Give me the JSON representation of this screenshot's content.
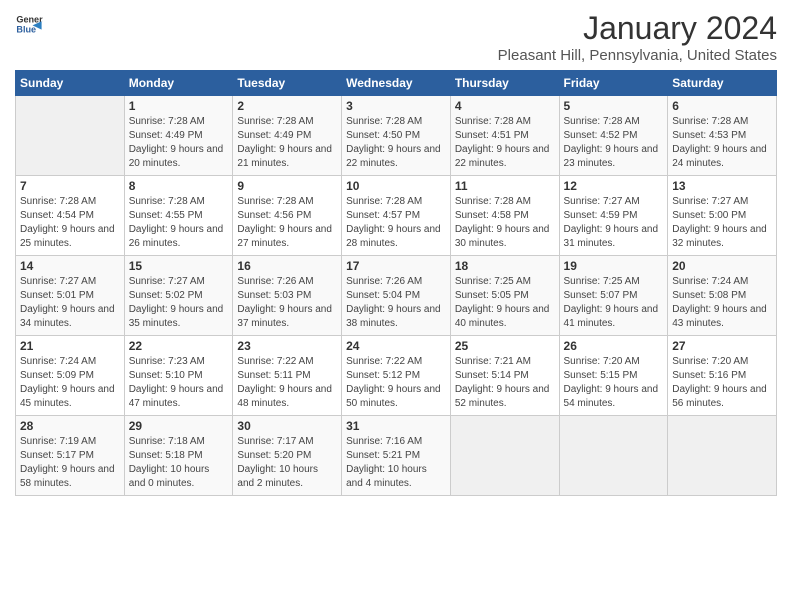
{
  "logo": {
    "general": "General",
    "blue": "Blue"
  },
  "header": {
    "month": "January 2024",
    "location": "Pleasant Hill, Pennsylvania, United States"
  },
  "weekdays": [
    "Sunday",
    "Monday",
    "Tuesday",
    "Wednesday",
    "Thursday",
    "Friday",
    "Saturday"
  ],
  "weeks": [
    [
      {
        "day": "",
        "sunrise": "",
        "sunset": "",
        "daylight": ""
      },
      {
        "day": "1",
        "sunrise": "Sunrise: 7:28 AM",
        "sunset": "Sunset: 4:49 PM",
        "daylight": "Daylight: 9 hours and 20 minutes."
      },
      {
        "day": "2",
        "sunrise": "Sunrise: 7:28 AM",
        "sunset": "Sunset: 4:49 PM",
        "daylight": "Daylight: 9 hours and 21 minutes."
      },
      {
        "day": "3",
        "sunrise": "Sunrise: 7:28 AM",
        "sunset": "Sunset: 4:50 PM",
        "daylight": "Daylight: 9 hours and 22 minutes."
      },
      {
        "day": "4",
        "sunrise": "Sunrise: 7:28 AM",
        "sunset": "Sunset: 4:51 PM",
        "daylight": "Daylight: 9 hours and 22 minutes."
      },
      {
        "day": "5",
        "sunrise": "Sunrise: 7:28 AM",
        "sunset": "Sunset: 4:52 PM",
        "daylight": "Daylight: 9 hours and 23 minutes."
      },
      {
        "day": "6",
        "sunrise": "Sunrise: 7:28 AM",
        "sunset": "Sunset: 4:53 PM",
        "daylight": "Daylight: 9 hours and 24 minutes."
      }
    ],
    [
      {
        "day": "7",
        "sunrise": "Sunrise: 7:28 AM",
        "sunset": "Sunset: 4:54 PM",
        "daylight": "Daylight: 9 hours and 25 minutes."
      },
      {
        "day": "8",
        "sunrise": "Sunrise: 7:28 AM",
        "sunset": "Sunset: 4:55 PM",
        "daylight": "Daylight: 9 hours and 26 minutes."
      },
      {
        "day": "9",
        "sunrise": "Sunrise: 7:28 AM",
        "sunset": "Sunset: 4:56 PM",
        "daylight": "Daylight: 9 hours and 27 minutes."
      },
      {
        "day": "10",
        "sunrise": "Sunrise: 7:28 AM",
        "sunset": "Sunset: 4:57 PM",
        "daylight": "Daylight: 9 hours and 28 minutes."
      },
      {
        "day": "11",
        "sunrise": "Sunrise: 7:28 AM",
        "sunset": "Sunset: 4:58 PM",
        "daylight": "Daylight: 9 hours and 30 minutes."
      },
      {
        "day": "12",
        "sunrise": "Sunrise: 7:27 AM",
        "sunset": "Sunset: 4:59 PM",
        "daylight": "Daylight: 9 hours and 31 minutes."
      },
      {
        "day": "13",
        "sunrise": "Sunrise: 7:27 AM",
        "sunset": "Sunset: 5:00 PM",
        "daylight": "Daylight: 9 hours and 32 minutes."
      }
    ],
    [
      {
        "day": "14",
        "sunrise": "Sunrise: 7:27 AM",
        "sunset": "Sunset: 5:01 PM",
        "daylight": "Daylight: 9 hours and 34 minutes."
      },
      {
        "day": "15",
        "sunrise": "Sunrise: 7:27 AM",
        "sunset": "Sunset: 5:02 PM",
        "daylight": "Daylight: 9 hours and 35 minutes."
      },
      {
        "day": "16",
        "sunrise": "Sunrise: 7:26 AM",
        "sunset": "Sunset: 5:03 PM",
        "daylight": "Daylight: 9 hours and 37 minutes."
      },
      {
        "day": "17",
        "sunrise": "Sunrise: 7:26 AM",
        "sunset": "Sunset: 5:04 PM",
        "daylight": "Daylight: 9 hours and 38 minutes."
      },
      {
        "day": "18",
        "sunrise": "Sunrise: 7:25 AM",
        "sunset": "Sunset: 5:05 PM",
        "daylight": "Daylight: 9 hours and 40 minutes."
      },
      {
        "day": "19",
        "sunrise": "Sunrise: 7:25 AM",
        "sunset": "Sunset: 5:07 PM",
        "daylight": "Daylight: 9 hours and 41 minutes."
      },
      {
        "day": "20",
        "sunrise": "Sunrise: 7:24 AM",
        "sunset": "Sunset: 5:08 PM",
        "daylight": "Daylight: 9 hours and 43 minutes."
      }
    ],
    [
      {
        "day": "21",
        "sunrise": "Sunrise: 7:24 AM",
        "sunset": "Sunset: 5:09 PM",
        "daylight": "Daylight: 9 hours and 45 minutes."
      },
      {
        "day": "22",
        "sunrise": "Sunrise: 7:23 AM",
        "sunset": "Sunset: 5:10 PM",
        "daylight": "Daylight: 9 hours and 47 minutes."
      },
      {
        "day": "23",
        "sunrise": "Sunrise: 7:22 AM",
        "sunset": "Sunset: 5:11 PM",
        "daylight": "Daylight: 9 hours and 48 minutes."
      },
      {
        "day": "24",
        "sunrise": "Sunrise: 7:22 AM",
        "sunset": "Sunset: 5:12 PM",
        "daylight": "Daylight: 9 hours and 50 minutes."
      },
      {
        "day": "25",
        "sunrise": "Sunrise: 7:21 AM",
        "sunset": "Sunset: 5:14 PM",
        "daylight": "Daylight: 9 hours and 52 minutes."
      },
      {
        "day": "26",
        "sunrise": "Sunrise: 7:20 AM",
        "sunset": "Sunset: 5:15 PM",
        "daylight": "Daylight: 9 hours and 54 minutes."
      },
      {
        "day": "27",
        "sunrise": "Sunrise: 7:20 AM",
        "sunset": "Sunset: 5:16 PM",
        "daylight": "Daylight: 9 hours and 56 minutes."
      }
    ],
    [
      {
        "day": "28",
        "sunrise": "Sunrise: 7:19 AM",
        "sunset": "Sunset: 5:17 PM",
        "daylight": "Daylight: 9 hours and 58 minutes."
      },
      {
        "day": "29",
        "sunrise": "Sunrise: 7:18 AM",
        "sunset": "Sunset: 5:18 PM",
        "daylight": "Daylight: 10 hours and 0 minutes."
      },
      {
        "day": "30",
        "sunrise": "Sunrise: 7:17 AM",
        "sunset": "Sunset: 5:20 PM",
        "daylight": "Daylight: 10 hours and 2 minutes."
      },
      {
        "day": "31",
        "sunrise": "Sunrise: 7:16 AM",
        "sunset": "Sunset: 5:21 PM",
        "daylight": "Daylight: 10 hours and 4 minutes."
      },
      {
        "day": "",
        "sunrise": "",
        "sunset": "",
        "daylight": ""
      },
      {
        "day": "",
        "sunrise": "",
        "sunset": "",
        "daylight": ""
      },
      {
        "day": "",
        "sunrise": "",
        "sunset": "",
        "daylight": ""
      }
    ]
  ]
}
